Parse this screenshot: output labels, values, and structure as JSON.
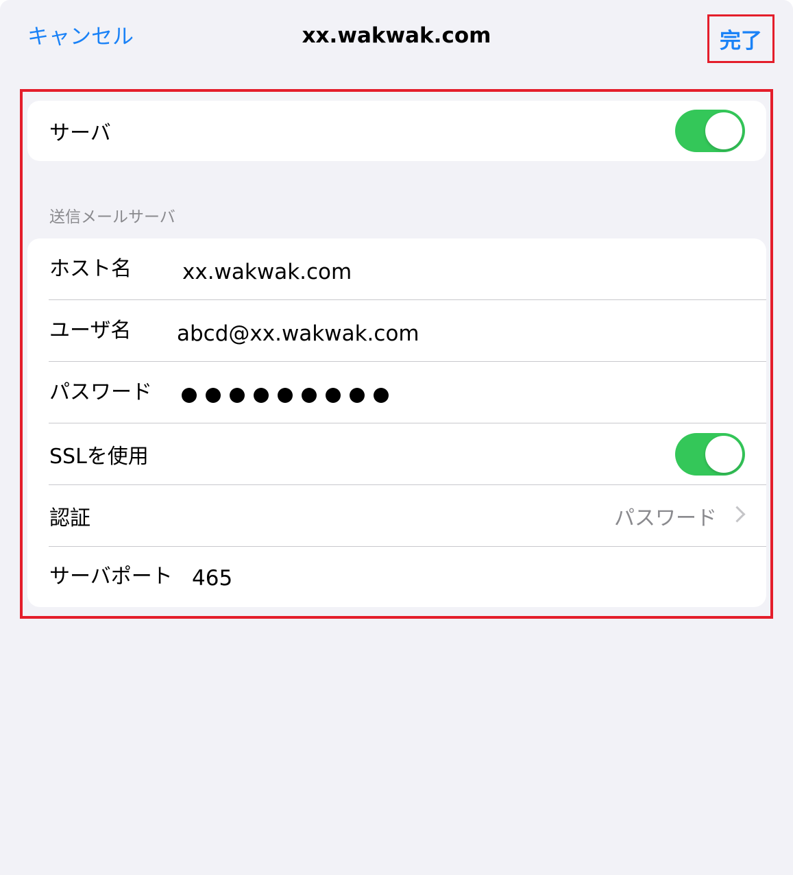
{
  "nav": {
    "cancel_label": "キャンセル",
    "title": "xx.wakwak.com",
    "done_label": "完了"
  },
  "server": {
    "label": "サーバ",
    "enabled": true
  },
  "smtp": {
    "section_header": "送信メールサーバ",
    "host_label": "ホスト名",
    "host_value": "xx.wakwak.com",
    "user_label": "ユーザ名",
    "user_value": "abcd@xx.wakwak.com",
    "password_label": "パスワード",
    "password_mask_count": 9,
    "ssl_label": "SSLを使用",
    "ssl_enabled": true,
    "auth_label": "認証",
    "auth_value": "パスワード",
    "port_label": "サーバポート",
    "port_value": "465"
  },
  "colors": {
    "accent": "#1a82f7",
    "toggle_on": "#34c759",
    "highlight": "#e41e2b",
    "background": "#f2f2f7",
    "secondary_text": "#8a8a8e"
  },
  "icons": {
    "disclosure": "chevron-right-icon"
  }
}
